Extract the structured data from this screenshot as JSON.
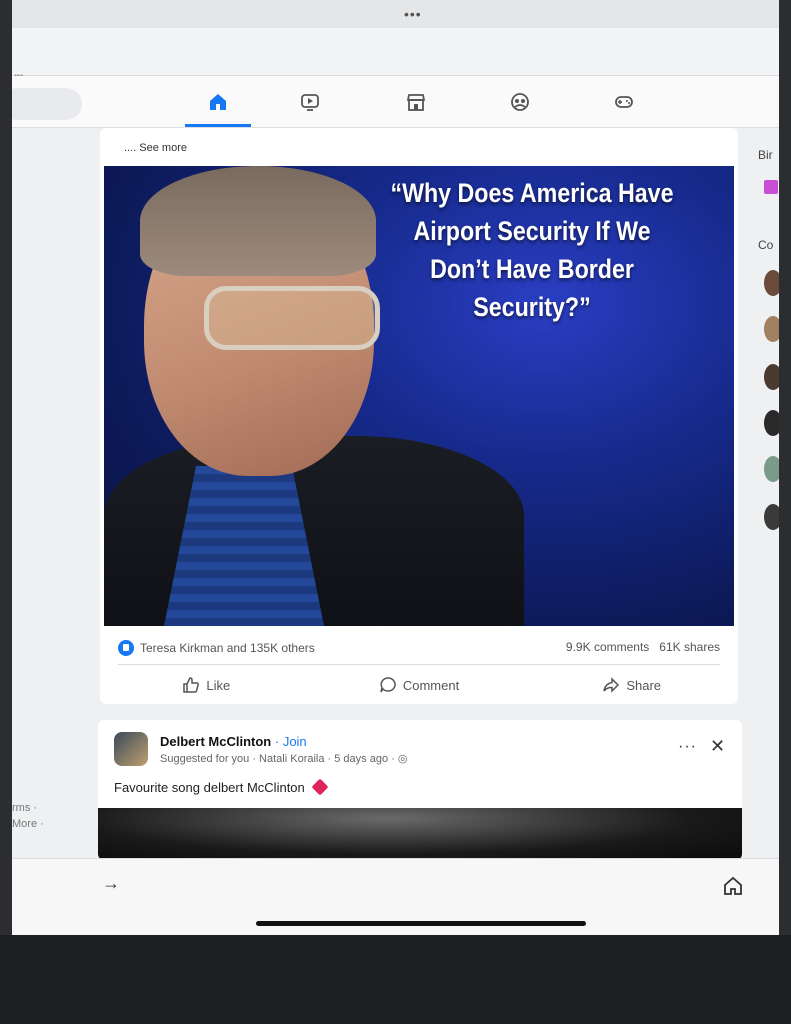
{
  "browser": {
    "more_dots": "•••",
    "url_fragment": "m"
  },
  "nav": {
    "tabs": [
      {
        "name": "home",
        "icon": "home-icon",
        "active": true
      },
      {
        "name": "video",
        "icon": "video-icon",
        "active": false
      },
      {
        "name": "marketplace",
        "icon": "marketplace-icon",
        "active": false
      },
      {
        "name": "groups",
        "icon": "groups-icon",
        "active": false
      },
      {
        "name": "gaming",
        "icon": "gaming-icon",
        "active": false
      }
    ],
    "accent_color": "#1877f2"
  },
  "left_sidebar": {
    "links": [
      "rms ·",
      "More ·"
    ]
  },
  "right_sidebar": {
    "birthdays_label": "Bir",
    "contacts_label": "Co"
  },
  "post1": {
    "see_more": ".... See more",
    "quote": "“Why Does America Have Airport Security If We Don’t Have Border Security?”",
    "reactions_text": "Teresa Kirkman and 135K others",
    "comments_count": "9.9K comments",
    "shares_count": "61K shares",
    "actions": {
      "like": "Like",
      "comment": "Comment",
      "share": "Share"
    }
  },
  "post2": {
    "author": "Delbert McClinton",
    "join_label": "Join",
    "suggested": "Suggested for you · Natali Koraila · 5 days ago ·",
    "text": "Favourite song delbert McClinton",
    "more": "···",
    "close": "✕"
  },
  "bottom_bar": {
    "forward_arrow": "→"
  }
}
